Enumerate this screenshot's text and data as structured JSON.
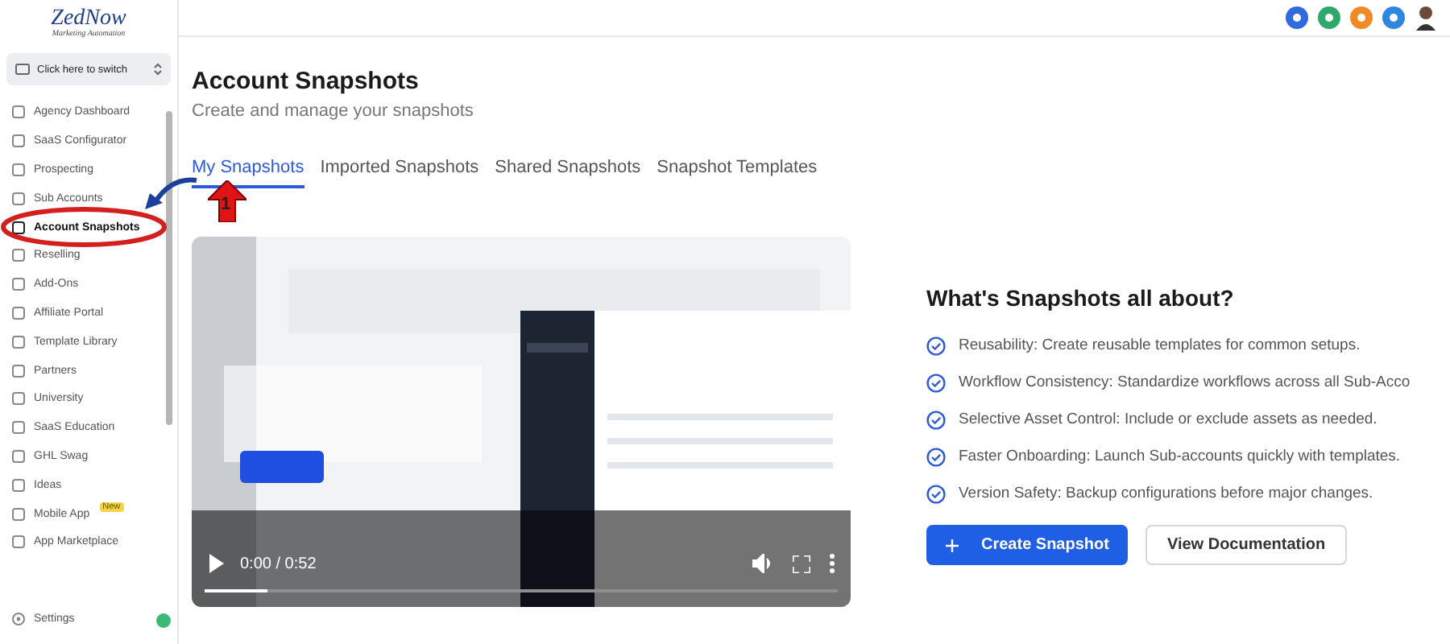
{
  "logo": {
    "name": "ZedNow",
    "tagline": "Marketing Automation"
  },
  "switcher": {
    "label": "Click here to switch"
  },
  "sidebar": {
    "items": [
      {
        "label": "Agency Dashboard",
        "selected": false
      },
      {
        "label": "SaaS Configurator",
        "selected": false
      },
      {
        "label": "Prospecting",
        "selected": false
      },
      {
        "label": "Sub Accounts",
        "selected": false
      },
      {
        "label": "Account Snapshots",
        "selected": true
      },
      {
        "label": "Reselling",
        "selected": false
      },
      {
        "label": "Add-Ons",
        "selected": false
      },
      {
        "label": "Affiliate Portal",
        "selected": false
      },
      {
        "label": "Template Library",
        "selected": false
      },
      {
        "label": "Partners",
        "selected": false
      },
      {
        "label": "University",
        "selected": false
      },
      {
        "label": "SaaS Education",
        "selected": false
      },
      {
        "label": "GHL Swag",
        "selected": false
      },
      {
        "label": "Ideas",
        "selected": false
      },
      {
        "label": "Mobile App",
        "selected": false,
        "badge": "New"
      },
      {
        "label": "App Marketplace",
        "selected": false
      }
    ],
    "footer": {
      "label": "Settings"
    }
  },
  "page": {
    "title": "Account Snapshots",
    "subtitle": "Create and manage your snapshots"
  },
  "tabs": [
    {
      "label": "My Snapshots",
      "selected": true
    },
    {
      "label": "Imported Snapshots",
      "selected": false
    },
    {
      "label": "Shared Snapshots",
      "selected": false
    },
    {
      "label": "Snapshot Templates",
      "selected": false
    }
  ],
  "video": {
    "kind": "picture",
    "time": "0:00 / 0:52",
    "level": 0.1
  },
  "about": {
    "heading": "What's Snapshots all about?",
    "points": [
      "Reusability: Create reusable templates for common setups.",
      "Workflow Consistency: Standardize workflows across all Sub-Acco",
      "Selective Asset Control: Include or exclude assets as needed.",
      "Faster Onboarding: Launch Sub-accounts quickly with templates.",
      "Version Safety: Backup configurations before major changes."
    ],
    "buttons": [
      {
        "label": "Create Snapshot",
        "kind": "primary"
      },
      {
        "label": "View Documentation",
        "kind": "secondary"
      }
    ]
  },
  "annotation": {
    "label": "1"
  }
}
